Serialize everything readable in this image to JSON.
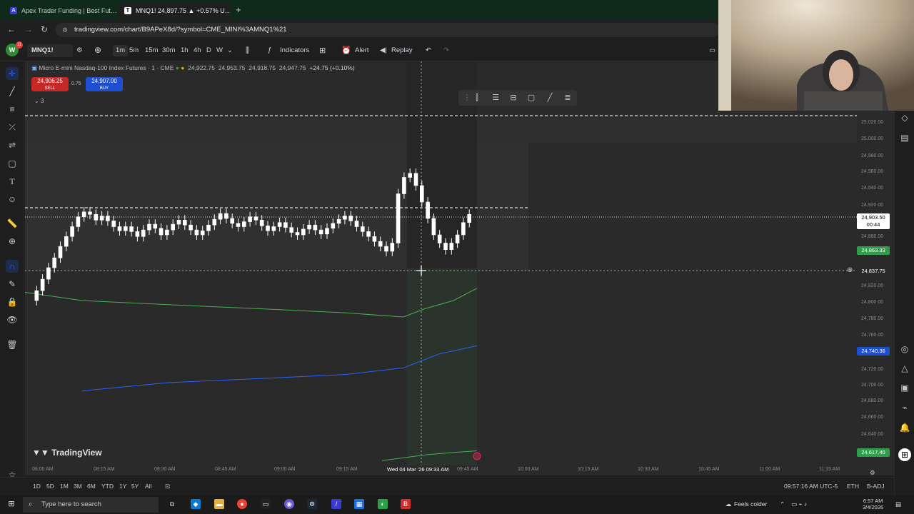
{
  "browser": {
    "tabs": [
      {
        "title": "Apex Trader Funding | Best Fut…",
        "active": false
      },
      {
        "title": "MNQ1! 24,897.75 ▲ +0.57% U…",
        "active": true
      }
    ],
    "url": "tradingview.com/chart/B9APeX8d/?symbol=CME_MINI%3AMNQ1%21"
  },
  "toolbar": {
    "avatar_letter": "W",
    "avatar_badge": "11",
    "symbol": "MNQ1!",
    "intervals": [
      "1m",
      "5m",
      "15m",
      "30m",
      "1h",
      "4h",
      "D",
      "W"
    ],
    "selected_interval": "1m",
    "indicators_label": "Indicators",
    "alert_label": "Alert",
    "replay_label": "Replay"
  },
  "legend": {
    "title": "Micro E-mini Nasdaq-100 Index Futures · 1 · CME",
    "open": "24,922.75",
    "high": "24,953.75",
    "low": "24,918.75",
    "close": "24,947.75",
    "change": "+24.75 (+0.10%)",
    "sell_price": "24,906.25",
    "sell_label": "SELL",
    "spread": "0.75",
    "buy_price": "24,907.00",
    "buy_label": "BUY",
    "indicator_count": "3"
  },
  "price_axis": {
    "ticks": [
      "25,020.00",
      "25,000.00",
      "24,980.00",
      "24,960.00",
      "24,940.00",
      "24,920.00",
      "24,880.00",
      "24,820.00",
      "24,800.00",
      "24,780.00",
      "24,760.00",
      "24,720.00",
      "24,700.00",
      "24,680.00",
      "24,660.00",
      "24,640.00"
    ],
    "current_price": "24,903.50",
    "countdown": "00:44",
    "green_level": "24,863.33",
    "cursor_price": "24,837.75",
    "blue_level": "24,740.36",
    "bottom_level": "24,617.40"
  },
  "time_axis": {
    "ticks": [
      "08:00 AM",
      "08:15 AM",
      "08:30 AM",
      "08:45 AM",
      "09:00 AM",
      "09:15 AM",
      "09:45 AM",
      "10:00 AM",
      "10:15 AM",
      "10:30 AM",
      "10:45 AM",
      "11:00 AM",
      "11:15 AM"
    ],
    "cursor_time": "Wed 04 Mar '26   09:33 AM"
  },
  "range_bar": {
    "ranges": [
      "1D",
      "5D",
      "1M",
      "3M",
      "6M",
      "YTD",
      "1Y",
      "5Y",
      "All"
    ],
    "clock": "09:57:16 AM UTC-5",
    "session": "ETH",
    "adj": "B-ADJ"
  },
  "branding": {
    "logo_text": "TradingView"
  },
  "taskbar": {
    "search_placeholder": "Type here to search",
    "weather": "Feels colder",
    "time": "6:57 AM",
    "date": "3/4/2026"
  },
  "colors": {
    "candle_up": "#ffffff",
    "candle_down": "#ffffff",
    "vwap_green": "#4caf50",
    "ma_blue": "#2962ff",
    "sell": "#c62828",
    "buy": "#1e4fd1",
    "label_green": "#2e9e4a"
  },
  "chart_data": {
    "type": "candlestick",
    "symbol": "MNQ1!",
    "interval": "1m",
    "ylim": [
      24600,
      25020
    ],
    "price_lines": {
      "current": 24903.5,
      "green_level": 24863.33,
      "cursor": 24837.75,
      "blue_level": 24740.36,
      "bottom_level": 24617.4
    }
  }
}
